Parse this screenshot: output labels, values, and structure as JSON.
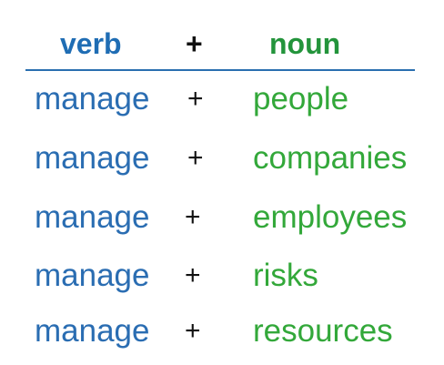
{
  "header": {
    "verb": "verb",
    "plus": "+",
    "noun": "noun"
  },
  "rows": [
    {
      "verb": "manage",
      "plus": "+",
      "noun": "people"
    },
    {
      "verb": "manage",
      "plus": "+",
      "noun": "companies"
    },
    {
      "verb": "manage",
      "plus": "+",
      "noun": "employees"
    },
    {
      "verb": "manage",
      "plus": "+",
      "noun": "risks"
    },
    {
      "verb": "manage",
      "plus": "+",
      "noun": "resources"
    }
  ],
  "colors": {
    "verb": "#2a6db2",
    "noun": "#33a83a",
    "divider": "#2a6fb0"
  }
}
